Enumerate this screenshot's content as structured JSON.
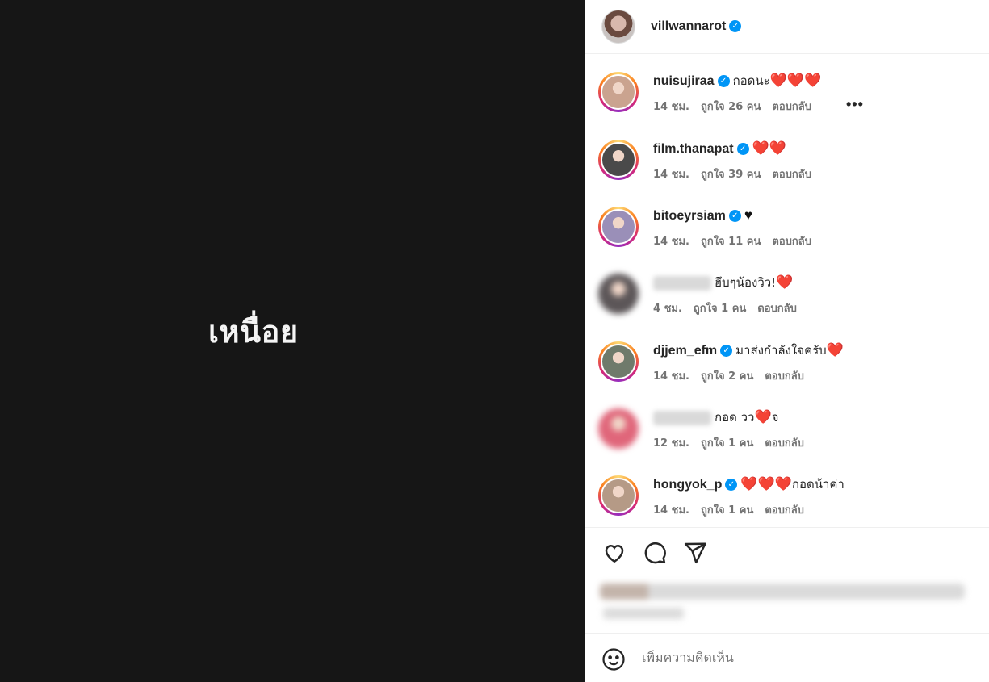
{
  "media": {
    "text": "เหนื่อย"
  },
  "header": {
    "username": "villwannarot",
    "verified": true
  },
  "comments": [
    {
      "username": "nuisujiraa",
      "verified": true,
      "text": "กอดนะ",
      "hearts": "❤️❤️❤️",
      "hearts_after": "",
      "time": "14 ชม.",
      "likes": "ถูกใจ 26 คน",
      "reply": "ตอบกลับ",
      "more": "•••",
      "blurred": false,
      "avatar_color": "#caa38f"
    },
    {
      "username": "film.thanapat",
      "verified": true,
      "text": "",
      "hearts": "❤️❤️",
      "hearts_after": "",
      "time": "14 ชม.",
      "likes": "ถูกใจ 39 คน",
      "reply": "ตอบกลับ",
      "blurred": false,
      "avatar_color": "#4a4a4a"
    },
    {
      "username": "bitoeyrsiam",
      "verified": true,
      "text": "",
      "hearts": "♥",
      "hearts_after": "",
      "time": "14 ชม.",
      "likes": "ถูกใจ 11 คน",
      "reply": "ตอบกลับ",
      "blurred": false,
      "avatar_color": "#9a8fb8"
    },
    {
      "username": "",
      "verified": false,
      "text": "ฮึบๆน้องวิว!",
      "hearts": "❤️",
      "hearts_after": "",
      "time": "4 ชม.",
      "likes": "ถูกใจ 1 คน",
      "reply": "ตอบกลับ",
      "blurred": true,
      "avatar_color": "#5c5658"
    },
    {
      "username": "djjem_efm",
      "verified": true,
      "text": "มาส่งกำลังใจครับ",
      "hearts": "❤️",
      "hearts_after": "",
      "time": "14 ชม.",
      "likes": "ถูกใจ 2 คน",
      "reply": "ตอบกลับ",
      "blurred": false,
      "avatar_color": "#6f7a6b"
    },
    {
      "username": "",
      "verified": false,
      "text": "กอด วว",
      "hearts": "❤️",
      "hearts_after": "จ",
      "time": "12 ชม.",
      "likes": "ถูกใจ 1 คน",
      "reply": "ตอบกลับ",
      "blurred": true,
      "avatar_color": "#e0667a"
    },
    {
      "username": "hongyok_p",
      "verified": true,
      "text": "",
      "hearts": "❤️❤️❤️",
      "hearts_after": "กอดน้าค่า",
      "time": "14 ชม.",
      "likes": "ถูกใจ 1 คน",
      "reply": "ตอบกลับ",
      "blurred": false,
      "avatar_color": "#b59a86"
    }
  ],
  "actions": {
    "like_icon": "heart-icon",
    "comment_icon": "comment-icon",
    "share_icon": "share-icon"
  },
  "add_comment": {
    "placeholder": "เพิ่มความคิดเห็น",
    "emoji_icon": "emoji-icon"
  }
}
